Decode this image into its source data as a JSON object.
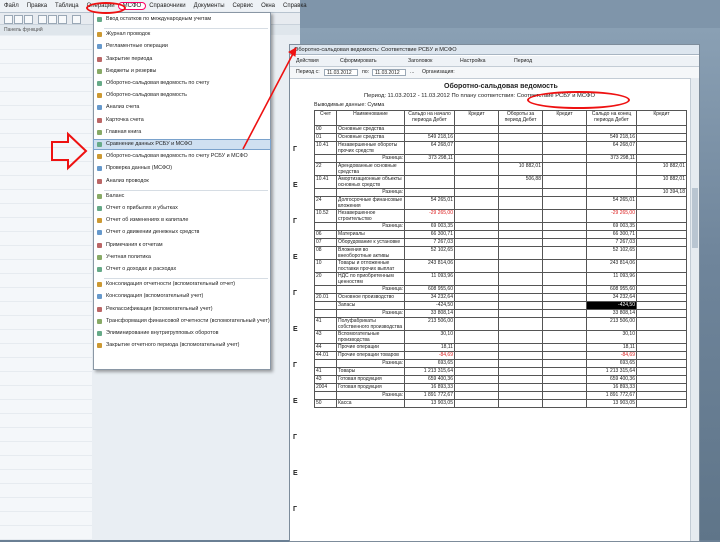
{
  "menubar": {
    "items": [
      "Файл",
      "Правка",
      "Таблица",
      "Операции",
      "МСФО",
      "Справочники",
      "Документы",
      "Сервис",
      "Окна",
      "Справка"
    ],
    "active_index": 4
  },
  "toolbar2": {
    "label": "Панель функций"
  },
  "dropdown": {
    "items": [
      {
        "label": "Ввод остатков по международным учетам",
        "hl": false
      },
      {
        "label": "Журнал проводок",
        "hl": false
      },
      {
        "label": "Регламентные операции",
        "hl": false
      },
      {
        "label": "Закрытие периода",
        "hl": false
      },
      {
        "label": "Бюджеты и резервы",
        "hl": false
      },
      {
        "label": "Оборотно-сальдовая ведомость по счету",
        "hl": false
      },
      {
        "label": "Оборотно-сальдовая ведомость",
        "hl": false
      },
      {
        "label": "Анализ счета",
        "hl": false
      },
      {
        "label": "Карточка счета",
        "hl": false
      },
      {
        "label": "Главная книга",
        "hl": false
      },
      {
        "label": "Сравнение данных РСБУ и МСФО",
        "hl": true
      },
      {
        "label": "Оборотно-сальдовая ведомость по счету РСБУ и МСФО",
        "hl": false
      },
      {
        "label": "Проверка данных (МСФО)",
        "hl": false
      },
      {
        "label": "Анализ проводок",
        "hl": false
      },
      {
        "label": "Баланс",
        "hl": false
      },
      {
        "label": "Отчет о прибылях и убытках",
        "hl": false
      },
      {
        "label": "Отчет об изменениях в капитале",
        "hl": false
      },
      {
        "label": "Отчет о движении денежных средств",
        "hl": false
      },
      {
        "label": "Примечания к отчетам",
        "hl": false
      },
      {
        "label": "Учетная политика",
        "hl": false
      },
      {
        "label": "Отчет о доходах и расходах",
        "hl": false
      },
      {
        "label": "Консолидация отчетности (вспомогательный отчет)",
        "hl": false
      },
      {
        "label": "Консолидация (вспомогательный учет)",
        "hl": false
      },
      {
        "label": "Реклассификация (вспомогательный учет)",
        "hl": false
      },
      {
        "label": "Трансформация финансовой отчетности (вспомогательный учет)",
        "hl": false
      },
      {
        "label": "Элиминирование внутригрупповых оборотов",
        "hl": false
      },
      {
        "label": "Закрытие отчетного периода (вспомогательный учет)",
        "hl": false
      }
    ]
  },
  "report": {
    "window_title": "Оборотно-сальдовая ведомость: Соответствие РСБУ и МСФО",
    "toolbar": [
      "Действия",
      "Сформировать",
      "Заголовок",
      "Настройка",
      "Период"
    ],
    "date_from": "11.03.2012",
    "date_to": "11.03.2012",
    "period_button": "...",
    "account_label": "Организация:",
    "sheet_title": "Оборотно-сальдовая ведомость",
    "sheet_subtitle": "Период: 11.03.2012 - 11.03.2012 По плану соответствия: Соответствие РСБУ и МСФО",
    "sheet_filter": "Выводимые данные: Сумма",
    "headers": [
      "Счет",
      "Наименование",
      "Сальдо на начало периода Дебет",
      "Кредит",
      "Обороты за период Дебет",
      "Кредит",
      "Сальдо на конец периода Дебет",
      "Кредит"
    ],
    "rows": [
      {
        "c": [
          "00",
          "Основные средства",
          "",
          "",
          "",
          "",
          "",
          ""
        ],
        "t": "n"
      },
      {
        "c": [
          "01",
          "Основные средства",
          "549 218,16",
          "",
          "",
          "",
          "549 218,16",
          ""
        ],
        "t": "n"
      },
      {
        "c": [
          "10.41",
          "Незавершенные обороты прочих средств",
          "64 268,07",
          "",
          "",
          "",
          "64 268,07",
          ""
        ],
        "t": "tall"
      },
      {
        "c": [
          "",
          "Разница:",
          "373 298,11",
          "",
          "",
          "",
          "373 298,11",
          ""
        ],
        "t": "sum"
      },
      {
        "c": [
          "22",
          "Арендованные основные средства",
          "",
          "",
          "10 882,01",
          "",
          "",
          "10 882,01"
        ],
        "t": "tall"
      },
      {
        "c": [
          "10.41",
          "Амортизационные объекты основных средств",
          "",
          "",
          "506,88",
          "",
          "",
          "10 882,01"
        ],
        "t": "tall2"
      },
      {
        "c": [
          "",
          "Разница:",
          "",
          "",
          "",
          "",
          "",
          "10 394,18"
        ],
        "t": "sum"
      },
      {
        "c": [
          "24",
          "Долгосрочные финансовые вложения",
          "54 265,01",
          "",
          "",
          "",
          "54 265,01",
          ""
        ],
        "t": "tall"
      },
      {
        "c": [
          "10.52",
          "Незавершенное строительство",
          "-29 265,00",
          "",
          "",
          "",
          "-29 265,00",
          ""
        ],
        "t": "tallred"
      },
      {
        "c": [
          "",
          "Разница:",
          "69 003,35",
          "",
          "",
          "",
          "69 003,35",
          ""
        ],
        "t": "sum"
      },
      {
        "c": [
          "06",
          "Материалы",
          "66 300,71",
          "",
          "",
          "",
          "66 300,71",
          ""
        ],
        "t": "n"
      },
      {
        "c": [
          "07",
          "Оборудование к установке",
          "7 267,03",
          "",
          "",
          "",
          "7 267,03",
          ""
        ],
        "t": "n"
      },
      {
        "c": [
          "08",
          "Вложения во внеоборотные активы",
          "52 102,65",
          "",
          "",
          "",
          "52 102,65",
          ""
        ],
        "t": "n"
      },
      {
        "c": [
          "10",
          "Товары и отложенные поставки прочих выплат",
          "243 814,06",
          "",
          "",
          "",
          "243 814,06",
          ""
        ],
        "t": "tall2"
      },
      {
        "c": [
          "20",
          "НДС по приобретенным ценностям",
          "11 093,96",
          "",
          "",
          "",
          "11 093,96",
          ""
        ],
        "t": "tall"
      },
      {
        "c": [
          "",
          "Разница:",
          "608 955,60",
          "",
          "",
          "",
          "608 955,60",
          ""
        ],
        "t": "sum"
      },
      {
        "c": [
          "20.01",
          "Основное производство",
          "34 232,64",
          "",
          "",
          "",
          "34 232,64",
          ""
        ],
        "t": "n"
      },
      {
        "c": [
          "",
          "Запасы",
          "-424,50",
          "",
          "",
          "",
          "-424,50",
          ""
        ],
        "t": "blk"
      },
      {
        "c": [
          "",
          "Разница:",
          "33 808,14",
          "",
          "",
          "",
          "33 808,14",
          ""
        ],
        "t": "sum"
      },
      {
        "c": [
          "41",
          "Полуфабрикаты собственного производства",
          "213 506,00",
          "",
          "",
          "",
          "213 506,00",
          ""
        ],
        "t": "tall2"
      },
      {
        "c": [
          "43",
          "Вспомогательные производства",
          "30,10",
          "",
          "",
          "",
          "30,10",
          ""
        ],
        "t": "tall"
      },
      {
        "c": [
          "44",
          "Прочие операции",
          "18,11",
          "",
          "",
          "",
          "18,11",
          ""
        ],
        "t": "n"
      },
      {
        "c": [
          "44.01",
          "Прочие операции товаров",
          "-84,69",
          "",
          "",
          "",
          "-84,69",
          ""
        ],
        "t": "tallred"
      },
      {
        "c": [
          "",
          "Разница:",
          "693,65",
          "",
          "",
          "",
          "693,65",
          ""
        ],
        "t": "sum"
      },
      {
        "c": [
          "41",
          "Товары",
          "1 213 315,64",
          "",
          "",
          "",
          "1 213 315,64",
          ""
        ],
        "t": "n"
      },
      {
        "c": [
          "43",
          "Готовая продукция",
          "659 400,36",
          "",
          "",
          "",
          "659 400,36",
          ""
        ],
        "t": "n"
      },
      {
        "c": [
          "2004",
          "Готовая продукция",
          "16 893,33",
          "",
          "",
          "",
          "16 893,33",
          ""
        ],
        "t": "n"
      },
      {
        "c": [
          "",
          "Разница:",
          "1 891 772,67",
          "",
          "",
          "",
          "1 891 772,67",
          ""
        ],
        "t": "sum"
      },
      {
        "c": [
          "50",
          "Касса",
          "13 903,05",
          "",
          "",
          "",
          "13 903,05",
          ""
        ],
        "t": "n"
      }
    ]
  },
  "marks": [
    "Г",
    "Е",
    "Г",
    "Е",
    "Г",
    "Е",
    "Г",
    "Е",
    "Г",
    "Е",
    "Г"
  ],
  "colors": {
    "highlight": "#cfe0f1",
    "annotation": "#e11111"
  }
}
